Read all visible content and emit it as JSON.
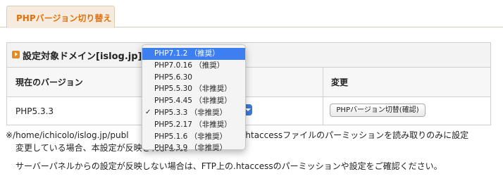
{
  "tab": {
    "label": "PHPバージョン切り替え"
  },
  "section": {
    "title": "設定対象ドメイン[islog.jp]"
  },
  "table": {
    "headers": [
      "現在のバージョン",
      "",
      "変更"
    ],
    "current_version": "PHP5.3.3",
    "change_button": "PHPバージョン切替(確認)"
  },
  "dropdown": {
    "selected_value": "PHP5.3.3",
    "options": [
      "PHP7.1.2 （推奨）",
      "PHP7.0.16 （推奨）",
      "PHP5.6.30",
      "PHP5.5.30 （非推奨）",
      "PHP5.4.45 （非推奨）",
      "PHP5.3.3 （非推奨）",
      "PHP5.2.17 （非推奨）",
      "PHP5.1.6 （非推奨）",
      "PHP4.3.9 （非推奨）"
    ],
    "highlighted_option": "PHP7.1.2 （推奨）",
    "checkmark": "✓"
  },
  "notes": {
    "line1_left": "※/home/ichicolo/islog.jp/publ",
    "line1_right": "る.htaccessファイルのパーミッションを読み取りのみに設定",
    "line2": "変更している場合、本設定が反映されません。",
    "line3": "サーバーパネルからの設定が反映しない場合は、FTP上の.htaccessのパーミッションや設定をご確認ください。"
  },
  "colors": {
    "accent": "#e4700b",
    "tab_bg": "#f5ecdf",
    "highlight": "#3d7ff0"
  }
}
